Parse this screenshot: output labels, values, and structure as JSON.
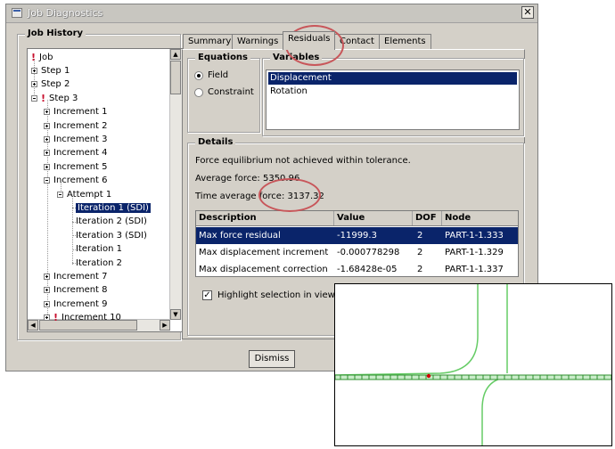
{
  "window": {
    "title": "Job Diagnostics",
    "close_glyph": "✕"
  },
  "job_history": {
    "label": "Job History",
    "items": [
      {
        "label": "Job",
        "icon": "warning-icon"
      },
      {
        "label": "Step 1"
      },
      {
        "label": "Step 2"
      },
      {
        "label": "Step 3",
        "icon": "warning-icon"
      },
      {
        "label": "Increment 1"
      },
      {
        "label": "Increment 2"
      },
      {
        "label": "Increment 3"
      },
      {
        "label": "Increment 4"
      },
      {
        "label": "Increment 5"
      },
      {
        "label": "Increment 6"
      },
      {
        "label": "Attempt 1"
      },
      {
        "label": "Iteration 1 (SDI)",
        "selected": true
      },
      {
        "label": "Iteration 2 (SDI)"
      },
      {
        "label": "Iteration 3 (SDI)"
      },
      {
        "label": "Iteration 1"
      },
      {
        "label": "Iteration 2"
      },
      {
        "label": "Increment 7"
      },
      {
        "label": "Increment 8"
      },
      {
        "label": "Increment 9"
      },
      {
        "label": "Increment 10",
        "icon": "warning-icon"
      }
    ]
  },
  "tabs": [
    "Summary",
    "Warnings",
    "Residuals",
    "Contact",
    "Elements"
  ],
  "active_tab": "Residuals",
  "equations": {
    "label": "Equations",
    "options": [
      "Field",
      "Constraint"
    ],
    "selected": "Field"
  },
  "variables": {
    "label": "Variables",
    "items": [
      "Displacement",
      "Rotation"
    ],
    "selected": "Displacement"
  },
  "details": {
    "label": "Details",
    "message": "Force equilibrium not achieved within tolerance.",
    "average_force": "Average force: 5350.96",
    "time_average_force": "Time average force: 3137.32",
    "columns": [
      "Description",
      "Value",
      "DOF",
      "Node"
    ],
    "rows": [
      [
        "Max force residual",
        "-11999.3",
        "2",
        "PART-1-1.333"
      ],
      [
        "Max displacement increment",
        "-0.000778298",
        "2",
        "PART-1-1.329"
      ],
      [
        "Max displacement correction",
        "-1.68428e-05",
        "2",
        "PART-1-1.337"
      ]
    ],
    "highlighted_row": 0
  },
  "highlight_checkbox": {
    "label": "Highlight selection in viewport",
    "checked": true
  },
  "dismiss_label": "Dismiss",
  "colors": {
    "selection": "#0a246a",
    "annotation": "#c8565a",
    "mesh_green": "#66cc66",
    "error_marker": "#d00000"
  }
}
